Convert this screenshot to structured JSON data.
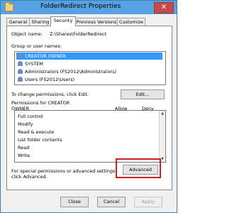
{
  "window": {
    "title": "FolderRedirect Properties",
    "close_glyph": "✕"
  },
  "tabs": [
    {
      "label": "General"
    },
    {
      "label": "Sharing"
    },
    {
      "label": "Security",
      "active": true
    },
    {
      "label": "Previous Versions"
    },
    {
      "label": "Customize"
    }
  ],
  "security": {
    "object_name_label": "Object name:",
    "object_name_value": "Z:\\Shares\\FolderRedirect",
    "group_label": "Group or user names:",
    "users": [
      {
        "name": "CREATOR OWNER",
        "selected": true
      },
      {
        "name": "SYSTEM"
      },
      {
        "name": "Administrators (FS2012\\Administrators)"
      },
      {
        "name": "Users (FS2012\\Users)"
      }
    ],
    "change_permissions_text": "To change permissions, click Edit.",
    "edit_button": "Edit...",
    "permissions_for_label": "Permissions for CREATOR\nOWNER",
    "permissions_for_line1": "Permissions for CREATOR",
    "permissions_for_line2": "OWNER",
    "allow_header": "Allow",
    "deny_header": "Deny",
    "permissions": [
      "Full control",
      "Modify",
      "Read & execute",
      "List folder contents",
      "Read",
      "Write"
    ],
    "special_text_line1": "For special permissions or advanced settings,",
    "special_text_line2": "click Advanced.",
    "advanced_button": "Advanced"
  },
  "footer": {
    "close": "Close",
    "cancel": "Cancel",
    "apply": "Apply"
  },
  "colors": {
    "titlebar": "#57a2e2",
    "selection": "#3399ff",
    "highlight_box": "#d21f1f",
    "close_button": "#c74a4a"
  }
}
